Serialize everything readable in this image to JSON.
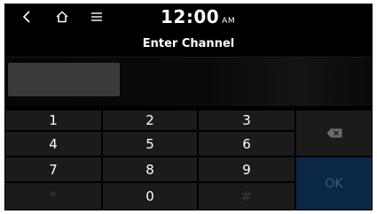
{
  "status_bar": {
    "time": "12:00",
    "ampm": "AM",
    "icons": [
      "back-arrow-icon",
      "home-icon",
      "menu-icon"
    ]
  },
  "header": {
    "title": "Enter Channel"
  },
  "input": {
    "value": ""
  },
  "keypad": {
    "keys": [
      "1",
      "2",
      "3",
      "4",
      "5",
      "6",
      "7",
      "8",
      "9",
      "*",
      "0",
      "#"
    ],
    "backspace_icon": "backspace-icon",
    "ok_label": "OK"
  },
  "colors": {
    "background": "#000000",
    "key": "#1b1b1c",
    "ok_disabled": "#0b2748",
    "input_box": "#3a3a3b"
  }
}
